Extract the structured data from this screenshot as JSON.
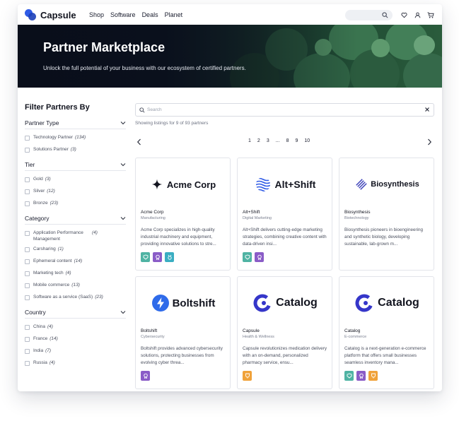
{
  "brand": {
    "name": "Capsule"
  },
  "nav": [
    "Shop",
    "Software",
    "Deals",
    "Planet"
  ],
  "hero": {
    "title": "Partner Marketplace",
    "subtitle": "Unlock the full potential of your business with our ecosystem of certified partners."
  },
  "sidebar": {
    "title": "Filter Partners By",
    "groups": [
      {
        "label": "Partner Type",
        "options": [
          {
            "label": "Technology Partner",
            "count": "(134)"
          },
          {
            "label": "Solutions Partner",
            "count": "(3)"
          }
        ]
      },
      {
        "label": "Tier",
        "options": [
          {
            "label": "Gold",
            "count": "(3)"
          },
          {
            "label": "Silver",
            "count": "(12)"
          },
          {
            "label": "Bronze",
            "count": "(23)"
          }
        ]
      },
      {
        "label": "Category",
        "options": [
          {
            "label": "Application Performance Management",
            "count": "(4)"
          },
          {
            "label": "Carsharing",
            "count": "(1)"
          },
          {
            "label": "Ephemeral content",
            "count": "(14)"
          },
          {
            "label": "Marketing tech",
            "count": "(4)"
          },
          {
            "label": "Mobile commerce",
            "count": "(13)"
          },
          {
            "label": "Software as a service (SaaS)",
            "count": "(23)"
          }
        ]
      },
      {
        "label": "Country",
        "options": [
          {
            "label": "China",
            "count": "(4)"
          },
          {
            "label": "France",
            "count": "(14)"
          },
          {
            "label": "India",
            "count": "(7)"
          },
          {
            "label": "Russia",
            "count": "(4)"
          }
        ]
      }
    ]
  },
  "search": {
    "placeholder": "Search",
    "value": ""
  },
  "results": {
    "text": "Showing listings for 9 of 93 partners"
  },
  "pagination": {
    "pages": [
      "1",
      "2",
      "3",
      "...",
      "8",
      "9",
      "10"
    ]
  },
  "cards": [
    {
      "brand": "Acme Corp",
      "name": "Acme Corp",
      "industry": "Manufacturing",
      "description": "Acme Corp specializes in high-quality industrial machinery and equipment, providing innovative solutions to stre...",
      "badges": [
        "teal",
        "purple",
        "cyan"
      ],
      "icon": "sparkle-icon",
      "color": "#12141f"
    },
    {
      "brand": "Alt+Shift",
      "name": "Alt+Shift",
      "industry": "Digital Marketing",
      "description": "Alt+Shift delivers cutting-edge marketing strategies, combining creative content with data-driven insi...",
      "badges": [
        "teal",
        "purple"
      ],
      "icon": "wave-globe-icon",
      "color": "#2f5be6"
    },
    {
      "brand": "Biosynthesis",
      "name": "Biosynthesis",
      "industry": "Biotechnology",
      "description": "Biosynthesis pioneers in bioengineering and synthetic biology, developing sustainable, lab-grown m...",
      "badges": [],
      "icon": "hatched-diamond-icon",
      "color": "#3a3fb8"
    },
    {
      "brand": "Boltshift",
      "name": "Boltshift",
      "industry": "Cybersecurity",
      "description": "Boltshift provides advanced cybersecurity solutions, protecting businesses from evolving cyber threa...",
      "badges": [
        "purple"
      ],
      "icon": "bolt-icon",
      "color": "#2f6bea"
    },
    {
      "brand": "Catalog",
      "name": "Capsule",
      "industry": "Health & Wellness",
      "description": "Capsule revolutionizes medication delivery with an on-demand, personalized pharmacy service, ensu...",
      "badges": [
        "orange"
      ],
      "icon": "c-ring-icon",
      "color": "#3536c9"
    },
    {
      "brand": "Catalog",
      "name": "Catalog",
      "industry": "E-commerce",
      "description": "Catalog is a next-generation e-commerce platform that offers small businesses seamless inventory mana...",
      "badges": [
        "teal",
        "purple",
        "orange"
      ],
      "icon": "c-ring-icon",
      "color": "#3536c9"
    }
  ]
}
